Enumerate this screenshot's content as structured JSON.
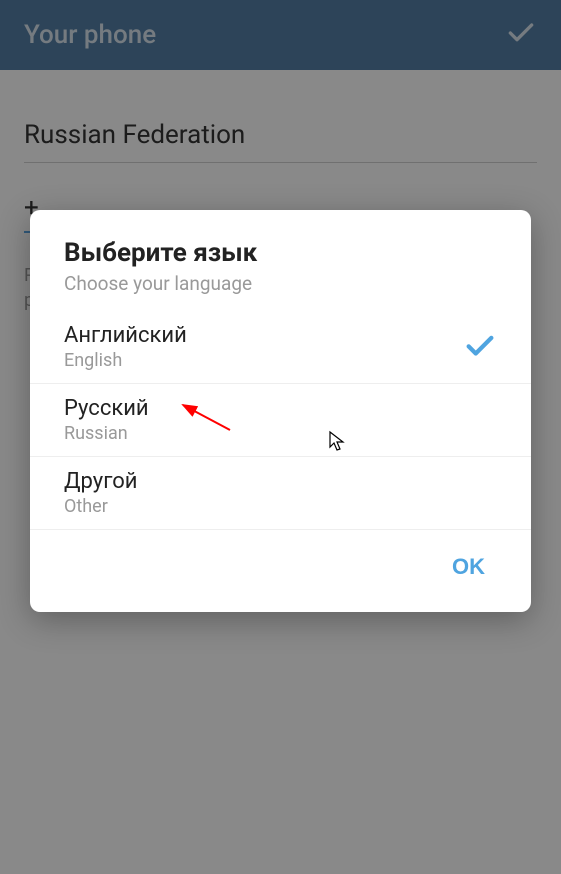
{
  "header": {
    "title": "Your phone"
  },
  "content": {
    "country": "Russian Federation",
    "phone_code": "+",
    "hint_line1": "P",
    "hint_line2": "p"
  },
  "dialog": {
    "title": "Выберите язык",
    "subtitle": "Choose your language",
    "options": [
      {
        "native": "Английский",
        "english": "English",
        "selected": true
      },
      {
        "native": "Русский",
        "english": "Russian",
        "selected": false
      },
      {
        "native": "Другой",
        "english": "Other",
        "selected": false
      }
    ],
    "ok_label": "OK"
  }
}
